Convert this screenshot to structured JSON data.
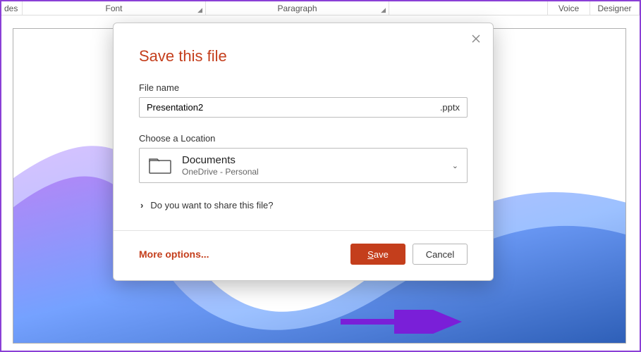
{
  "ribbon": {
    "slides": "des",
    "font": "Font",
    "paragraph": "Paragraph",
    "voice": "Voice",
    "designer": "Designer"
  },
  "dialog": {
    "title": "Save this file",
    "filename_label": "File name",
    "filename_value": "Presentation2",
    "file_ext": ".pptx",
    "location_label": "Choose a Location",
    "location_name": "Documents",
    "location_path": "OneDrive - Personal",
    "share_prompt": "Do you want to share this file?",
    "more_options": "More options...",
    "save": "Save",
    "cancel": "Cancel"
  },
  "annotation": {
    "arrow_color": "#7a1fd8"
  }
}
